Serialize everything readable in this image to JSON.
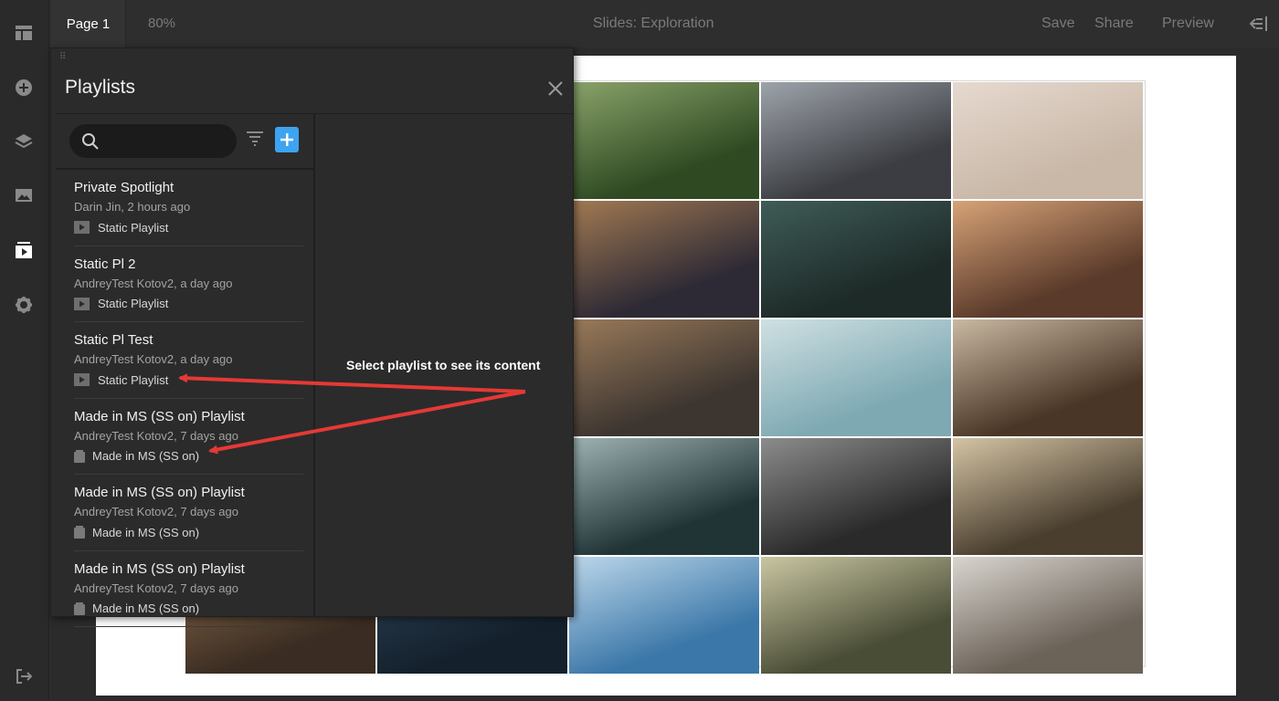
{
  "sidebar": {
    "items": [
      {
        "icon": "layout-icon"
      },
      {
        "icon": "add-circle-icon"
      },
      {
        "icon": "layers-icon"
      },
      {
        "icon": "image-icon"
      },
      {
        "icon": "playlist-icon",
        "active": true
      },
      {
        "icon": "gear-icon"
      }
    ],
    "bottom_icon": "exit-icon"
  },
  "topbar": {
    "page_tab": "Page 1",
    "zoom": "80%",
    "title": "Slides: Exploration",
    "save": "Save",
    "share": "Share",
    "preview": "Preview"
  },
  "panel": {
    "title": "Playlists",
    "search": {
      "placeholder": "",
      "value": ""
    },
    "accent_color": "#3ea3f0",
    "items": [
      {
        "name": "Private Spotlight",
        "meta": "Darin Jin, 2 hours ago",
        "type": "Static Playlist",
        "type_icon": "play-box-icon"
      },
      {
        "name": "Static Pl 2",
        "meta": "AndreyTest Kotov2, a day ago",
        "type": "Static Playlist",
        "type_icon": "play-box-icon"
      },
      {
        "name": "Static Pl Test",
        "meta": "AndreyTest Kotov2, a day ago",
        "type": "Static Playlist",
        "type_icon": "play-box-icon"
      },
      {
        "name": "Made in MS (SS on) Playlist",
        "meta": "AndreyTest Kotov2, 7 days ago",
        "type": "Made in MS (SS on)",
        "type_icon": "folder-icon"
      },
      {
        "name": "Made in MS (SS on) Playlist",
        "meta": "AndreyTest Kotov2, 7 days ago",
        "type": "Made in MS (SS on)",
        "type_icon": "folder-icon"
      },
      {
        "name": "Made in MS (SS on) Playlist",
        "meta": "AndreyTest Kotov2, 7 days ago",
        "type": "Made in MS (SS on)",
        "type_icon": "folder-icon"
      }
    ]
  },
  "annotation": {
    "text": "Select playlist to see its content",
    "color": "#e53935"
  },
  "gallery": {
    "tiles": [
      {
        "subject": "forest canopy",
        "colors": [
          "#2f4a22",
          "#8aa36a"
        ]
      },
      {
        "subject": "city street traffic",
        "colors": [
          "#3b3d42",
          "#9ea3aa"
        ]
      },
      {
        "subject": "beach sunbathers",
        "colors": [
          "#c9b8a8",
          "#e6d9cf"
        ]
      },
      {
        "subject": "hillside dusk",
        "colors": [
          "#2e2a35",
          "#a27a52"
        ]
      },
      {
        "subject": "pine forest",
        "colors": [
          "#1d2a28",
          "#3f5c57"
        ]
      },
      {
        "subject": "sunlit room",
        "colors": [
          "#5a3a2a",
          "#d7a277"
        ]
      },
      {
        "subject": "foggy highway night",
        "colors": [
          "#3c3530",
          "#9a7a5a"
        ]
      },
      {
        "subject": "cable cars",
        "colors": [
          "#7ea9b3",
          "#cfe0e2"
        ]
      },
      {
        "subject": "coffee beans",
        "colors": [
          "#4a3626",
          "#c9b8a2"
        ]
      },
      {
        "subject": "bridge underside",
        "colors": [
          "#203436",
          "#9fb3b4"
        ]
      },
      {
        "subject": "misty city skyline",
        "colors": [
          "#2a2a2a",
          "#8c8c8c"
        ]
      },
      {
        "subject": "coastal cliffs",
        "colors": [
          "#4a3e2f",
          "#d4c4a4"
        ]
      },
      {
        "subject": "wooden boardwalk",
        "colors": [
          "#3a2c22",
          "#8a6a4a"
        ]
      },
      {
        "subject": "night sky",
        "colors": [
          "#14202c",
          "#2c4356"
        ]
      },
      {
        "subject": "ocean coastline",
        "colors": [
          "#3b77a8",
          "#bcd7ea"
        ]
      },
      {
        "subject": "railway tracks",
        "colors": [
          "#4a4d36",
          "#c9c6a2"
        ]
      },
      {
        "subject": "mountain slope",
        "colors": [
          "#6b6258",
          "#d9d5cf"
        ]
      }
    ]
  }
}
